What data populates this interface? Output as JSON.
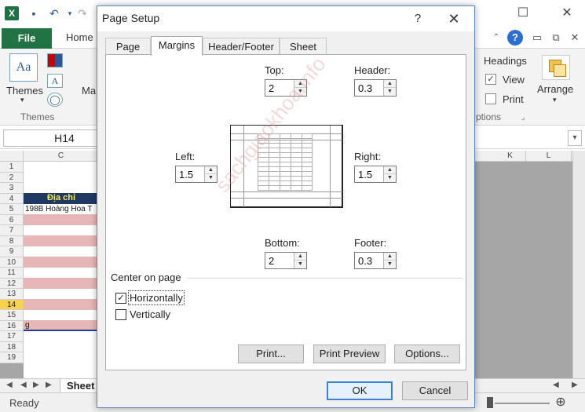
{
  "excel": {
    "ribbon_tabs": {
      "file": "File",
      "home": "Home"
    },
    "ribbon": {
      "themes": "Themes",
      "themes_group": "Themes",
      "themes_icon_text": "Aa",
      "partial_margins": "Ma",
      "headings": "Headings",
      "view": "View",
      "print": "Print",
      "options_group": "ptions",
      "arrange": "Arrange"
    },
    "namebox": "H14",
    "columns": [
      "C",
      "K",
      "L"
    ],
    "rows": [
      "1",
      "2",
      "3",
      "4",
      "5",
      "6",
      "7",
      "8",
      "9",
      "10",
      "11",
      "12",
      "13",
      "14",
      "15",
      "16",
      "17",
      "18",
      "19"
    ],
    "header_cell": "Địa chỉ",
    "data_cell": "198B Hoàng Hoa T",
    "row15_fragment": "g",
    "sheet_tab": "Sheet",
    "status": "Ready",
    "watermark": "sachgiaokhoa.info"
  },
  "dialog": {
    "title": "Page Setup",
    "help": "?",
    "close": "✕",
    "tabs": [
      "Page",
      "Margins",
      "Header/Footer",
      "Sheet"
    ],
    "active_tab": "Margins",
    "fields": {
      "top": {
        "label": "Top:",
        "value": "2"
      },
      "header": {
        "label": "Header:",
        "value": "0.3"
      },
      "left": {
        "label": "Left:",
        "value": "1.5"
      },
      "right": {
        "label": "Right:",
        "value": "1.5"
      },
      "bottom": {
        "label": "Bottom:",
        "value": "2"
      },
      "footer": {
        "label": "Footer:",
        "value": "0.3"
      }
    },
    "center_on_page": "Center on page",
    "horizontally": {
      "label": "Horizontally",
      "checked": true
    },
    "vertically": {
      "label": "Vertically",
      "checked": false
    },
    "buttons": {
      "print": "Print...",
      "print_preview": "Print Preview",
      "options": "Options...",
      "ok": "OK",
      "cancel": "Cancel"
    }
  }
}
